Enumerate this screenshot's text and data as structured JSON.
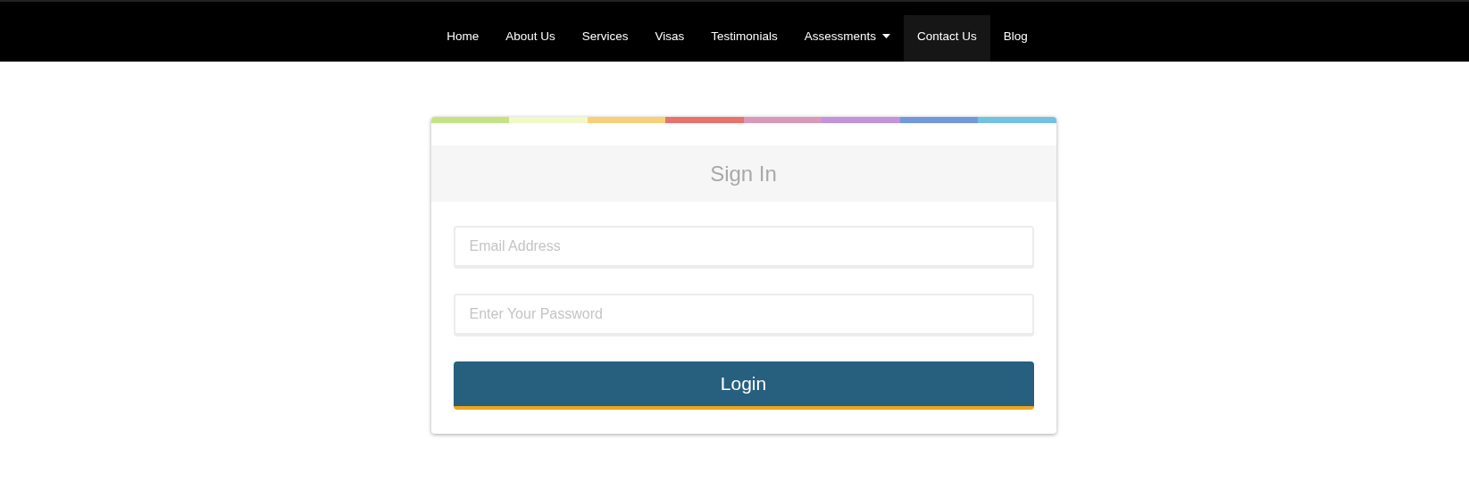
{
  "nav": {
    "items": [
      {
        "label": "Home",
        "selected": false,
        "has_menu": false
      },
      {
        "label": "About Us",
        "selected": false,
        "has_menu": false
      },
      {
        "label": "Services",
        "selected": false,
        "has_menu": false
      },
      {
        "label": "Visas",
        "selected": false,
        "has_menu": false
      },
      {
        "label": "Testimonials",
        "selected": false,
        "has_menu": false
      },
      {
        "label": "Assessments",
        "selected": false,
        "has_menu": true
      },
      {
        "label": "Contact Us",
        "selected": true,
        "has_menu": false
      },
      {
        "label": "Blog",
        "selected": false,
        "has_menu": false
      }
    ]
  },
  "login": {
    "title": "Sign In",
    "fields": [
      {
        "placeholder": "Email Address"
      },
      {
        "placeholder": "Enter Your Password"
      }
    ],
    "button": "Login"
  }
}
